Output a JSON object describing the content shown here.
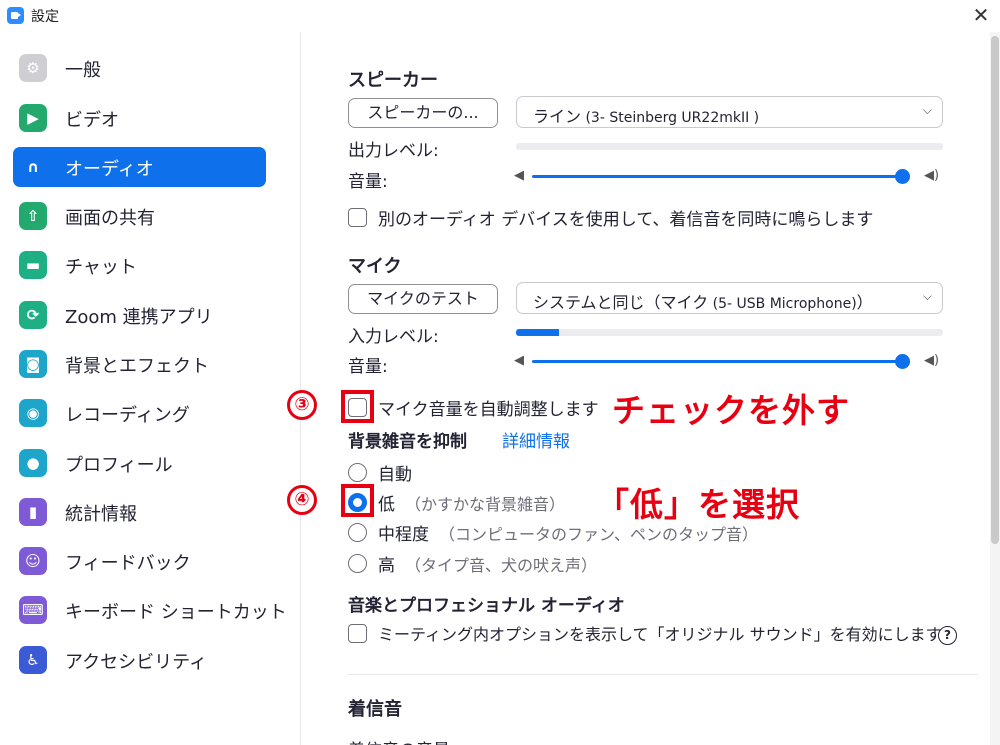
{
  "window": {
    "title": "設定",
    "close_glyph": "✕"
  },
  "sidebar": {
    "items": [
      {
        "label": "一般",
        "icon": "gear-icon",
        "glyph": "⚙",
        "color": "#cfcfd3"
      },
      {
        "label": "ビデオ",
        "icon": "video-icon",
        "glyph": "▶",
        "color": "#23a96e"
      },
      {
        "label": "オーディオ",
        "icon": "headphones-icon",
        "glyph": "∩",
        "color": "#0e71eb",
        "active": true
      },
      {
        "label": "画面の共有",
        "icon": "share-screen-icon",
        "glyph": "⇧",
        "color": "#23a96e"
      },
      {
        "label": "チャット",
        "icon": "chat-icon",
        "glyph": "▬",
        "color": "#1eaf85"
      },
      {
        "label": "Zoom 連携アプリ",
        "icon": "apps-icon",
        "glyph": "⟳",
        "color": "#1eaf85"
      },
      {
        "label": "背景とエフェクト",
        "icon": "background-icon",
        "glyph": "◙",
        "color": "#1da6c9"
      },
      {
        "label": "レコーディング",
        "icon": "record-icon",
        "glyph": "◉",
        "color": "#1da6c9"
      },
      {
        "label": "プロフィール",
        "icon": "profile-icon",
        "glyph": "●",
        "color": "#1da6c9"
      },
      {
        "label": "統計情報",
        "icon": "statistics-icon",
        "glyph": "▮",
        "color": "#7f5ad6"
      },
      {
        "label": "フィードバック",
        "icon": "feedback-icon",
        "glyph": "☺",
        "color": "#7f5ad6"
      },
      {
        "label": "キーボード ショートカット",
        "icon": "keyboard-icon",
        "glyph": "⌨",
        "color": "#7f5ad6"
      },
      {
        "label": "アクセシビリティ",
        "icon": "accessibility-icon",
        "glyph": "♿",
        "color": "#3b5bd6"
      }
    ]
  },
  "speaker": {
    "title": "スピーカー",
    "test_button": "スピーカーの...",
    "device_main": "ライン",
    "device_sub": " (3- Steinberg UR22mkII )",
    "output_level_label": "出力レベル:",
    "output_level": 0,
    "volume_label": "音量:",
    "volume": 1.0
  },
  "separate_device": {
    "label": "別のオーディオ デバイスを使用して、着信音を同時に鳴らします",
    "checked": false
  },
  "mic": {
    "title": "マイク",
    "test_button": "マイクのテスト",
    "device_main": "システムと同じ（マイク",
    "device_sub": " (5- USB Microphone)",
    "device_end": "）",
    "input_level_label": "入力レベル:",
    "input_level": 0.1,
    "volume_label": "音量:",
    "volume": 1.0,
    "auto_adjust_label": "マイク音量を自動調整します",
    "auto_adjust_checked": false
  },
  "noise": {
    "title": "背景雑音を抑制",
    "link": "詳細情報",
    "options": [
      {
        "label": "自動",
        "sub": "",
        "checked": false
      },
      {
        "label": "低",
        "sub": "（かすかな背景雑音）",
        "checked": true
      },
      {
        "label": "中程度",
        "sub": "（コンピュータのファン、ペンのタップ音）",
        "checked": false
      },
      {
        "label": "高",
        "sub": "（タイプ音、犬の吠え声）",
        "checked": false
      }
    ]
  },
  "music": {
    "title": "音楽とプロフェショナル オーディオ",
    "original_sound_label": "ミーティング内オプションを表示して「オリジナル サウンド」を有効にします",
    "checked": false,
    "help_glyph": "?"
  },
  "ringtone": {
    "title": "着信音",
    "volume_label": "着信音の音量"
  },
  "annotations": {
    "num3": "③",
    "text3": "チェックを外す",
    "num4": "④",
    "text4": "「低」を選択",
    "color": "#e60012"
  },
  "colors": {
    "accent": "#0e71eb",
    "text": "#232333",
    "annotation": "#e60012"
  }
}
